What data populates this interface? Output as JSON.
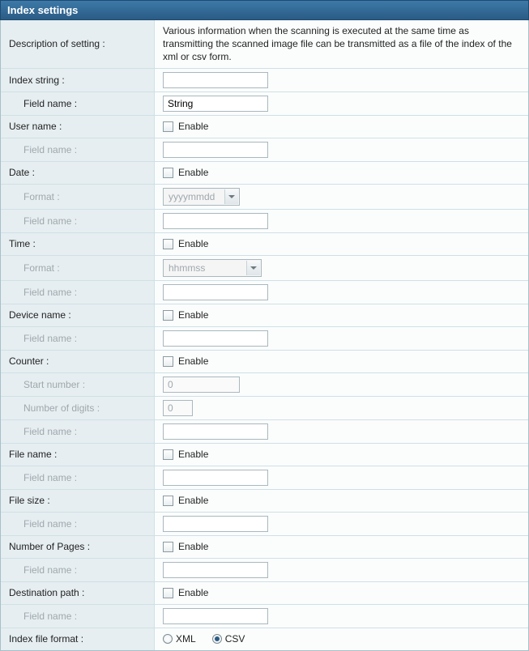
{
  "title": "Index settings",
  "labels": {
    "description": "Description of setting :",
    "indexString": "Index string :",
    "fieldName": "Field name :",
    "userName": "User name :",
    "date": "Date :",
    "format": "Format :",
    "time": "Time :",
    "deviceName": "Device name :",
    "counter": "Counter :",
    "startNumber": "Start number :",
    "numberOfDigits": "Number of digits :",
    "fileName": "File name :",
    "fileSize": "File size :",
    "numberOfPages": "Number of Pages :",
    "destinationPath": "Destination path :",
    "indexFileFormat": "Index file format :"
  },
  "controls": {
    "enable": "Enable",
    "xml": "XML",
    "csv": "CSV"
  },
  "values": {
    "description": "Various information when the scanning is executed at the same time as transmitting the scanned image file can be transmitted as a file of the index of the xml or csv form.",
    "indexString": {
      "value": "",
      "fieldName": "String"
    },
    "userName": {
      "enable": false,
      "fieldName": ""
    },
    "date": {
      "enable": false,
      "format": "yyyymmdd",
      "fieldName": ""
    },
    "time": {
      "enable": false,
      "format": "hhmmss",
      "fieldName": ""
    },
    "deviceName": {
      "enable": false,
      "fieldName": ""
    },
    "counter": {
      "enable": false,
      "startNumber": "0",
      "numberOfDigits": "0",
      "fieldName": ""
    },
    "fileName": {
      "enable": false,
      "fieldName": ""
    },
    "fileSize": {
      "enable": false,
      "fieldName": ""
    },
    "numberOfPages": {
      "enable": false,
      "fieldName": ""
    },
    "destinationPath": {
      "enable": false,
      "fieldName": ""
    },
    "indexFileFormat": "csv"
  }
}
